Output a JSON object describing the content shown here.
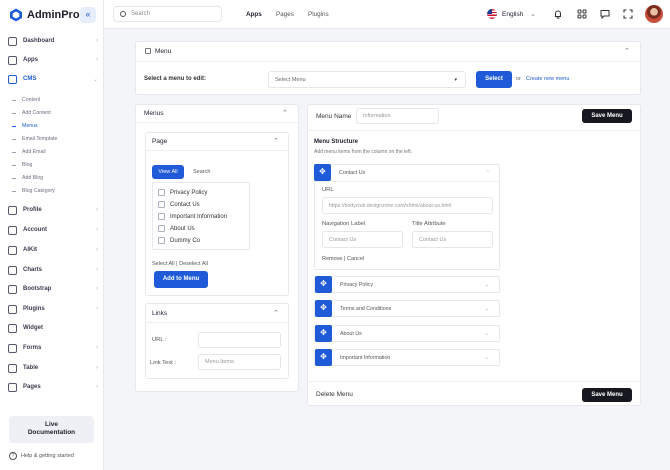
{
  "app": {
    "name_bold": "AdminPro",
    "name_rest": ""
  },
  "sidebar": {
    "collapse_icon": "«",
    "items": [
      {
        "label": "Dashboard"
      },
      {
        "label": "Apps"
      },
      {
        "label": "CMS"
      }
    ],
    "cms_sub": [
      "Content",
      "Add Content",
      "Menus",
      "Email Template",
      "Add Email",
      "Blog",
      "Add Blog",
      "Blog Category"
    ],
    "items2": [
      {
        "label": "Profile"
      },
      {
        "label": "Account"
      },
      {
        "label": "AIKit"
      },
      {
        "label": "Charts"
      },
      {
        "label": "Bootstrap"
      },
      {
        "label": "Plugins"
      },
      {
        "label": "Widget"
      },
      {
        "label": "Forms"
      },
      {
        "label": "Table"
      },
      {
        "label": "Pages"
      }
    ],
    "live_doc_line1": "Live",
    "live_doc_line2": "Documentation",
    "help": "Help & getting started"
  },
  "topbar": {
    "search_placeholder": "Search",
    "nav": [
      "Apps",
      "Pages",
      "Plugins"
    ],
    "language": "English"
  },
  "menu_card": {
    "title": "Menu",
    "select_label": "Select a menu to edit:",
    "select_value": "Select Menu",
    "select_button": "Select",
    "or_text": "or",
    "create_link": "Create new menu"
  },
  "menus_panel": {
    "title": "Menus",
    "page_section": {
      "title": "Page",
      "tabs": [
        "View All",
        "Search"
      ],
      "pages": [
        "Privacy Policy",
        "Contact Us",
        "Important Information",
        "About Us",
        "Dummy Co"
      ],
      "select_all": "Select All",
      "separator": "|",
      "deselect_all": "Deselect All",
      "add_button": "Add to Menu"
    },
    "links_section": {
      "title": "Links",
      "url_label": "URL :",
      "url_value": "",
      "link_text_label": "Link Text :",
      "link_text_placeholder": "Menu Items"
    }
  },
  "structure": {
    "menu_name_label": "Menu Name",
    "menu_name_placeholder": "Information",
    "save_button": "Save Menu",
    "title": "Menu Structure",
    "subtitle": "Add menu items from the column on the left.",
    "expanded_item": {
      "label": "Contact Us",
      "url_label": "URL",
      "url_value": "https://bodyclub.dexignzone.com/xhtml/about-us.html",
      "nav_label": "Navigation Label",
      "nav_placeholder": "Contact Us",
      "title_attr_label": "Title Attribute",
      "title_attr_placeholder": "Contact Us",
      "remove": "Remove",
      "separator": "|",
      "cancel": "Cancel"
    },
    "items": [
      "Privacy Policy",
      "Terms and Conditions",
      "About Us",
      "Important Information"
    ],
    "delete_link": "Delete Menu",
    "save_button_bottom": "Save Menu"
  },
  "colors": {
    "accent": "#1f5bd8",
    "dark": "#16171f"
  }
}
